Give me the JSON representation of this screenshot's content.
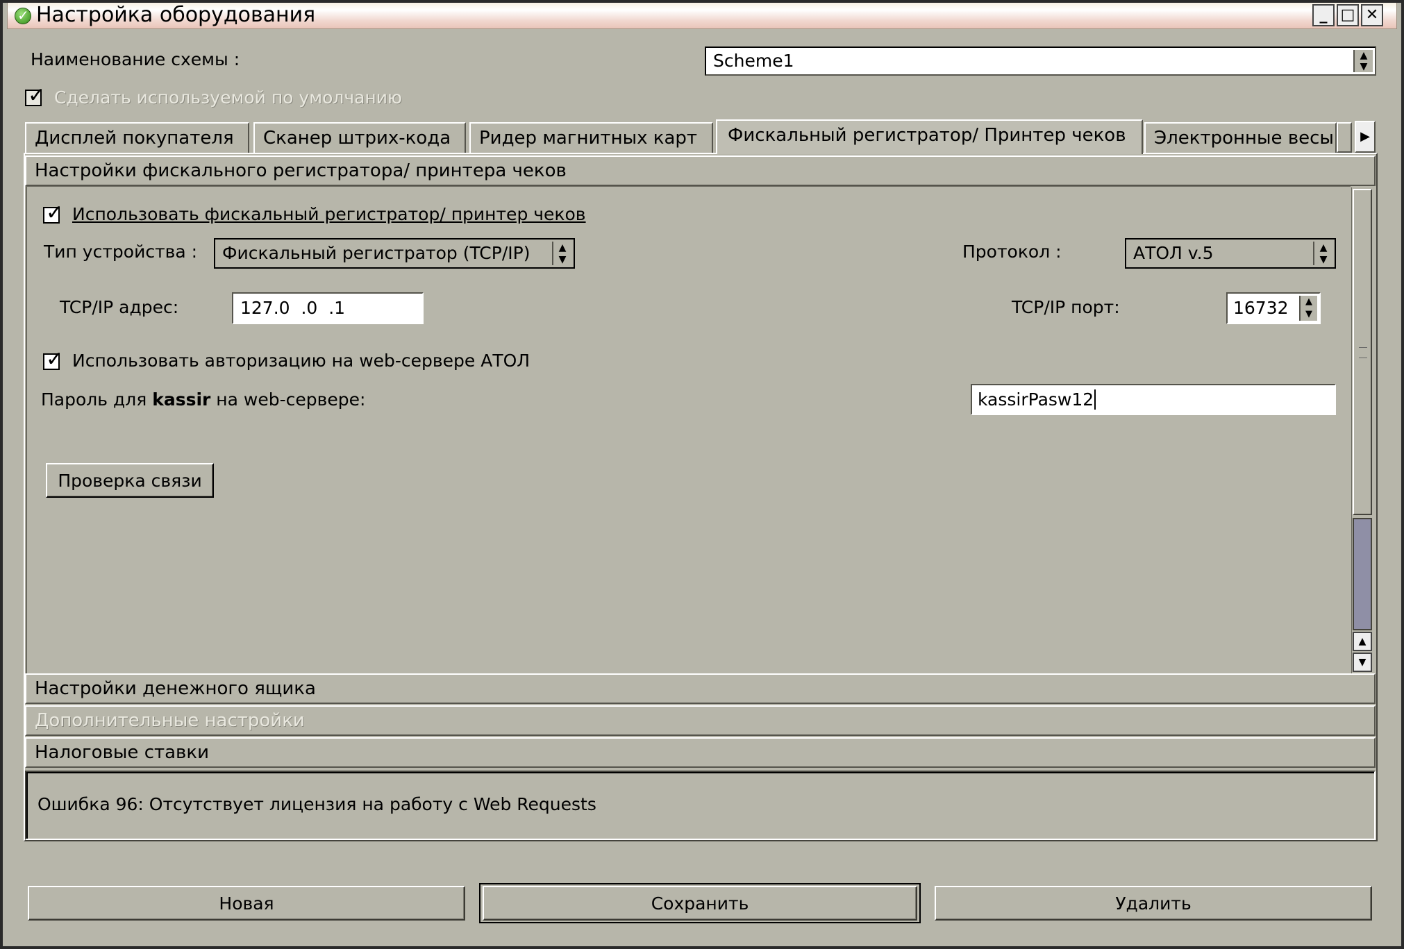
{
  "window": {
    "title": "Настройка оборудования",
    "controls": {
      "minimize": "_",
      "maximize": "□",
      "close": "✕"
    }
  },
  "scheme": {
    "label": "Наименование схемы :",
    "value": "Scheme1",
    "default_checkbox": {
      "label": "Сделать используемой по умолчанию",
      "checked": true,
      "enabled": false
    }
  },
  "tabs": [
    {
      "label": "Дисплей покупателя",
      "active": false
    },
    {
      "label": "Сканер штрих-кода",
      "active": false
    },
    {
      "label": "Ридер магнитных карт",
      "active": false
    },
    {
      "label": "Фискальный регистратор/ Принтер чеков",
      "active": true
    },
    {
      "label": "Электронные весы",
      "active": false
    }
  ],
  "fiscal": {
    "section_title": "Настройки фискального регистратора/ принтера чеков",
    "use_checkbox": {
      "label": "Использовать фискальный регистратор/ принтер чеков",
      "checked": true
    },
    "device_type": {
      "label": "Тип устройства :",
      "value": "Фискальный регистратор (TCP/IP)"
    },
    "protocol": {
      "label": "Протокол :",
      "value": "АТОЛ v.5"
    },
    "ip": {
      "label": "TCP/IP адрес:",
      "value": "127.0  .0  .1"
    },
    "port": {
      "label": "TCP/IP порт:",
      "value": "16732"
    },
    "auth_checkbox": {
      "label": "Использовать авторизацию на web-сервере АТОЛ",
      "checked": true
    },
    "password": {
      "label_prefix": "Пароль для ",
      "label_user": "kassir",
      "label_suffix": " на web-сервере:",
      "value": "kassirPasw12"
    },
    "check_button": "Проверка связи"
  },
  "sections": {
    "cash_drawer": "Настройки денежного ящика",
    "additional": "Дополнительные настройки",
    "tax_rates": "Налоговые ставки"
  },
  "status_message": "Ошибка 96: Отсутствует лицензия на работу с Web Requests",
  "buttons": {
    "new": "Новая",
    "save": "Сохранить",
    "delete": "Удалить"
  },
  "colors": {
    "background": "#b7b6aa",
    "scroll_thumb": "#8f8fa6",
    "titlebar": "#f1d8d0"
  }
}
